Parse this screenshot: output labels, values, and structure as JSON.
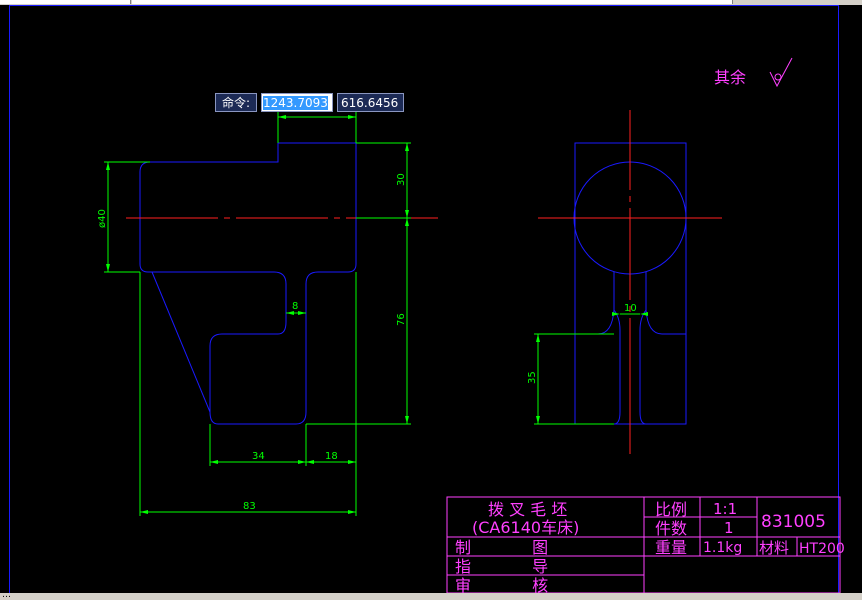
{
  "command": {
    "prompt_label": "命令:",
    "x_value": "1243.7093",
    "y_value": "616.6456"
  },
  "drawing": {
    "surface_note": "其余",
    "dimensions": {
      "diameter": "ø40",
      "height_30": "30",
      "height_76": "76",
      "rib_width": "8",
      "width_34": "34",
      "width_18": "18",
      "overall_83": "83",
      "side_10": "10",
      "side_35": "35"
    },
    "title_block": {
      "part_name": "拨 叉 毛 坯",
      "part_sub": "(CA6140车床)",
      "scale_label": "比例",
      "scale_value": "1:1",
      "qty_label": "件数",
      "qty_value": "1",
      "drawing_number": "831005",
      "weight_label": "重量",
      "weight_value": "1.1kg",
      "material_label": "材料",
      "material_value": "HT200",
      "drawn_label": "制 图",
      "guide_label": "指 导",
      "review_label": "审 核"
    }
  },
  "colors": {
    "background": "#000000",
    "outline": "#1a1aff",
    "dimension": "#00ff00",
    "centerline": "#ff2020",
    "annotation": "#ff40ff"
  },
  "status_text": "…"
}
